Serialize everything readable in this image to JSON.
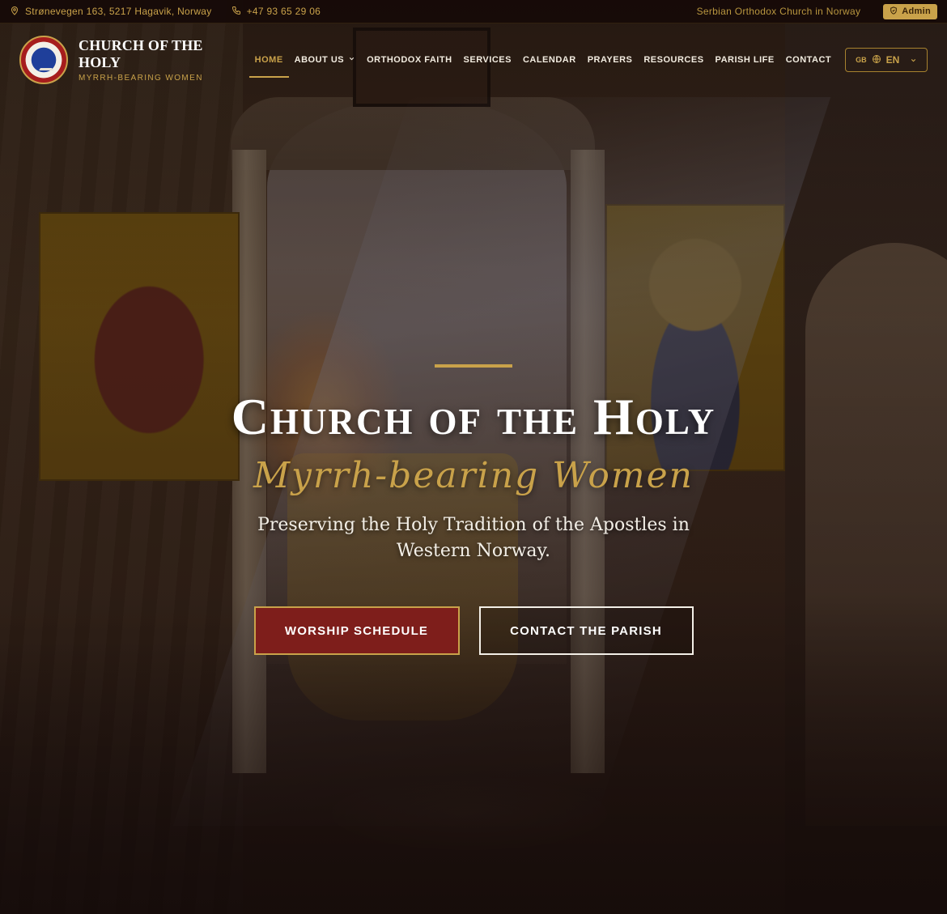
{
  "topbar": {
    "address": "Strønevegen 163, 5217 Hagavik, Norway",
    "phone": "+47 93 65 29 06",
    "tagline": "Serbian Orthodox Church in Norway",
    "admin_label": "Admin"
  },
  "brand": {
    "title": "CHURCH OF THE HOLY",
    "subtitle": "MYRRH-BEARING WOMEN"
  },
  "nav": {
    "items": [
      {
        "label": "HOME",
        "active": true
      },
      {
        "label": "ABOUT US",
        "dropdown": true
      },
      {
        "label": "ORTHODOX FAITH"
      },
      {
        "label": "SERVICES"
      },
      {
        "label": "CALENDAR"
      },
      {
        "label": "PRAYERS"
      },
      {
        "label": "RESOURCES"
      },
      {
        "label": "PARISH LIFE"
      },
      {
        "label": "CONTACT"
      }
    ],
    "language": {
      "flag": "GB",
      "code": "EN"
    }
  },
  "hero": {
    "title": "Church of the Holy",
    "subtitle": "Myrrh-bearing Women",
    "tagline": "Preserving the Holy Tradition of the Apostles in Western Norway.",
    "primary_button": "WORSHIP SCHEDULE",
    "secondary_button": "CONTACT THE PARISH"
  },
  "colors": {
    "accent_gold": "#c9a24a",
    "primary_red": "#7e1e1b",
    "topbar_bg": "#160a08"
  },
  "icons": {
    "address": "map-pin-icon",
    "phone": "phone-icon",
    "admin": "shield-icon",
    "language": "globe-icon",
    "dropdown": "chevron-down-icon"
  }
}
